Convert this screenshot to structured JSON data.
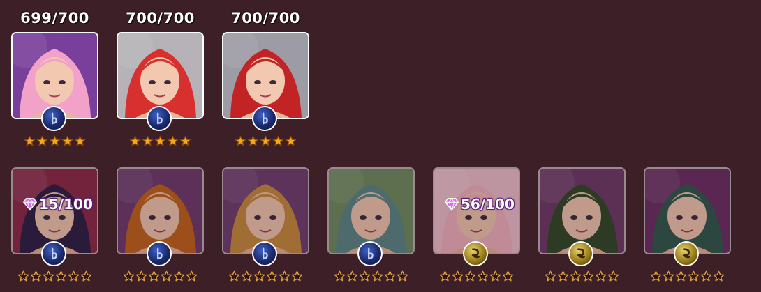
{
  "top_row": [
    {
      "count": "699/700",
      "stars_filled": 5,
      "orb": "blue",
      "art": "pink-demon-horns",
      "hair": "#f2a2c8",
      "bg": "#7a3f9b"
    },
    {
      "count": "700/700",
      "stars_filled": 5,
      "orb": "blue",
      "art": "red-hair-girl",
      "hair": "#d8302e",
      "bg": "#b6b2b7"
    },
    {
      "count": "700/700",
      "stars_filled": 5,
      "orb": "blue",
      "art": "red-hair-ahegao",
      "hair": "#c22426",
      "bg": "#9d9ba4"
    }
  ],
  "bottom_row": [
    {
      "progress": "15/100",
      "stars_filled": 0,
      "orb": "blue",
      "art": "dark-hair-girl",
      "hair": "#2a1f45",
      "bg": "#8e2a4a"
    },
    {
      "progress": "",
      "stars_filled": 0,
      "orb": "blue",
      "art": "ginger-braids",
      "hair": "#c5651d",
      "bg": "#6e3b6e"
    },
    {
      "progress": "",
      "stars_filled": 0,
      "orb": "blue",
      "art": "oni-horns",
      "hair": "#c88d3f",
      "bg": "#6f3e72"
    },
    {
      "progress": "",
      "stars_filled": 0,
      "orb": "blue",
      "art": "teal-hair-forest",
      "hair": "#5a8a8a",
      "bg": "#6f8f60"
    },
    {
      "progress": "56/100",
      "stars_filled": 0,
      "orb": "gold",
      "art": "pink-hair-crown",
      "hair": "#f3b4c0",
      "bg": "#efc2cf"
    },
    {
      "progress": "",
      "stars_filled": 0,
      "orb": "gold",
      "art": "green-hair-goggles",
      "hair": "#2f4a2a",
      "bg": "#6e3b6a"
    },
    {
      "progress": "",
      "stars_filled": 0,
      "orb": "gold",
      "art": "green-hood",
      "hair": "#2d5a4e",
      "bg": "#6a2f64"
    }
  ],
  "colors": {
    "background": "#3d1f27",
    "star_filled": "#f5a623",
    "star_empty_outline": "#e0a040"
  }
}
